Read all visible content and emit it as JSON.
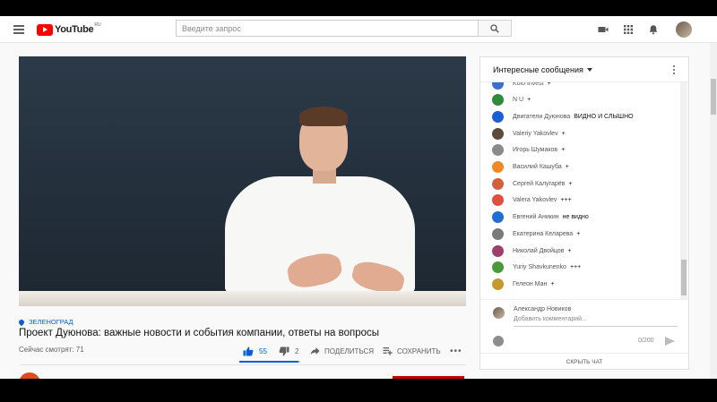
{
  "header": {
    "logo_text": "YouTube",
    "logo_region": "RU",
    "search_placeholder": "Введите запрос",
    "icons": [
      "menu-icon",
      "search-icon",
      "video-camera-icon",
      "apps-grid-icon",
      "bell-icon"
    ]
  },
  "video": {
    "location": "ЗЕЛЕНОГРАД",
    "title": "Проект Дуюнова: важные новости и события компании, ответы на вопросы",
    "viewers": "Сейчас смотрят: 71",
    "likes": "55",
    "dislikes": "2",
    "share_label": "ПОДЕЛИТЬСЯ",
    "save_label": "СОХРАНИТЬ",
    "like_ratio": 0.965,
    "accent_color": "#065fd4"
  },
  "chat": {
    "title": "Интересные сообщения",
    "messages": [
      {
        "author": "Kolo Invest",
        "text": "+",
        "color": "#3b6fd1"
      },
      {
        "author": "N U",
        "text": "+",
        "color": "#2e8b3a"
      },
      {
        "author": "Двигатели Дуюнова",
        "text": "ВИДНО И СЛЫШНО",
        "color": "#1a5fd6"
      },
      {
        "author": "Valeriy Yakovlev",
        "text": "+",
        "color": "#5e4a3a"
      },
      {
        "author": "Игорь Шумаков",
        "text": "+",
        "color": "#8a8a8a"
      },
      {
        "author": "Василий Кашуба",
        "text": "+",
        "color": "#f08a24"
      },
      {
        "author": "Сергей Калугарёв",
        "text": "+",
        "color": "#d1603d"
      },
      {
        "author": "Valera Yakovlev",
        "text": "+++",
        "color": "#e04e3c"
      },
      {
        "author": "Евгений Аникин",
        "text": "не видно",
        "color": "#1f6ed4"
      },
      {
        "author": "Екатерина Келарева",
        "text": "+",
        "color": "#7a7a7a"
      },
      {
        "author": "Николай Двойцов",
        "text": "+",
        "color": "#9b3f6b"
      },
      {
        "author": "Yuriy Shavkunenko",
        "text": "+++",
        "color": "#4a9a3a"
      },
      {
        "author": "Гелеон Ман",
        "text": "+",
        "color": "#c59a2a"
      }
    ],
    "current_user": "Александр Новиков",
    "input_placeholder": "Добавить комментарий...",
    "char_counter": "0/200",
    "hide_label": "СКРЫТЬ ЧАТ"
  }
}
